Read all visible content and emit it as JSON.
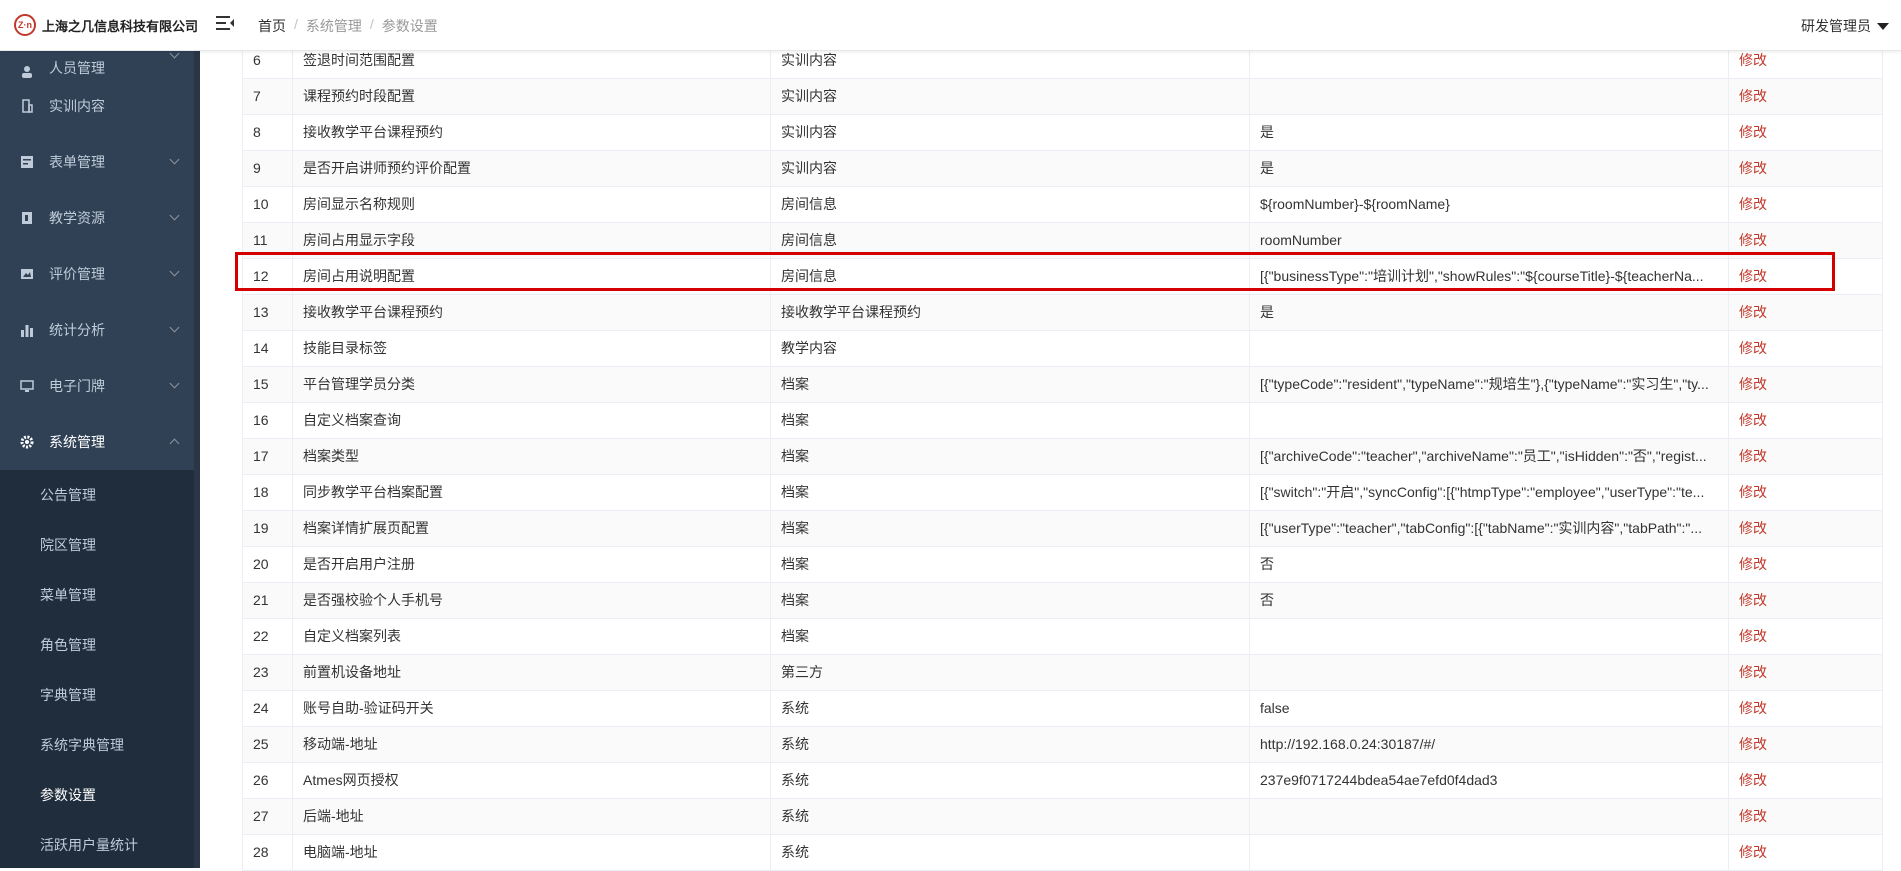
{
  "header": {
    "logo_mark": "Z·n",
    "company": "上海之几信息科技有限公司",
    "breadcrumb": [
      "首页",
      "系统管理",
      "参数设置"
    ],
    "user": "研发管理员"
  },
  "sidebar": {
    "top_partial": "人员管理",
    "items": [
      {
        "label": "实训内容",
        "icon": "building-icon"
      },
      {
        "label": "表单管理",
        "icon": "form-icon"
      },
      {
        "label": "教学资源",
        "icon": "book-icon"
      },
      {
        "label": "评价管理",
        "icon": "image-icon"
      },
      {
        "label": "统计分析",
        "icon": "bar-chart-icon"
      },
      {
        "label": "电子门牌",
        "icon": "monitor-icon"
      },
      {
        "label": "系统管理",
        "icon": "gear-icon"
      }
    ],
    "submenu": [
      "公告管理",
      "院区管理",
      "菜单管理",
      "角色管理",
      "字典管理",
      "系统字典管理",
      "参数设置",
      "活跃用户量统计"
    ],
    "active_sub": "参数设置"
  },
  "table": {
    "edit_label": "修改",
    "rows": [
      {
        "no": "6",
        "name": "签退时间范围配置",
        "category": "实训内容",
        "value": ""
      },
      {
        "no": "7",
        "name": "课程预约时段配置",
        "category": "实训内容",
        "value": ""
      },
      {
        "no": "8",
        "name": "接收教学平台课程预约",
        "category": "实训内容",
        "value": "是"
      },
      {
        "no": "9",
        "name": "是否开启讲师预约评价配置",
        "category": "实训内容",
        "value": "是"
      },
      {
        "no": "10",
        "name": "房间显示名称规则",
        "category": "房间信息",
        "value": "${roomNumber}-${roomName}"
      },
      {
        "no": "11",
        "name": "房间占用显示字段",
        "category": "房间信息",
        "value": "roomNumber"
      },
      {
        "no": "12",
        "name": "房间占用说明配置",
        "category": "房间信息",
        "value": "[{\"businessType\":\"培训计划\",\"showRules\":\"${courseTitle}-${teacherNa..."
      },
      {
        "no": "13",
        "name": "接收教学平台课程预约",
        "category": "接收教学平台课程预约",
        "value": "是"
      },
      {
        "no": "14",
        "name": "技能目录标签",
        "category": "教学内容",
        "value": ""
      },
      {
        "no": "15",
        "name": "平台管理学员分类",
        "category": "档案",
        "value": "[{\"typeCode\":\"resident\",\"typeName\":\"规培生\"},{\"typeName\":\"实习生\",\"ty..."
      },
      {
        "no": "16",
        "name": "自定义档案查询",
        "category": "档案",
        "value": ""
      },
      {
        "no": "17",
        "name": "档案类型",
        "category": "档案",
        "value": "[{\"archiveCode\":\"teacher\",\"archiveName\":\"员工\",\"isHidden\":\"否\",\"regist..."
      },
      {
        "no": "18",
        "name": "同步教学平台档案配置",
        "category": "档案",
        "value": "[{\"switch\":\"开启\",\"syncConfig\":[{\"htmpType\":\"employee\",\"userType\":\"te..."
      },
      {
        "no": "19",
        "name": "档案详情扩展页配置",
        "category": "档案",
        "value": "[{\"userType\":\"teacher\",\"tabConfig\":[{\"tabName\":\"实训内容\",\"tabPath\":\"..."
      },
      {
        "no": "20",
        "name": "是否开启用户注册",
        "category": "档案",
        "value": "否"
      },
      {
        "no": "21",
        "name": "是否强校验个人手机号",
        "category": "档案",
        "value": "否"
      },
      {
        "no": "22",
        "name": "自定义档案列表",
        "category": "档案",
        "value": ""
      },
      {
        "no": "23",
        "name": "前置机设备地址",
        "category": "第三方",
        "value": ""
      },
      {
        "no": "24",
        "name": "账号自助-验证码开关",
        "category": "系统",
        "value": "false"
      },
      {
        "no": "25",
        "name": "移动端-地址",
        "category": "系统",
        "value": "http://192.168.0.24:30187/#/"
      },
      {
        "no": "26",
        "name": "Atmes网页授权",
        "category": "系统",
        "value": "237e9f0717244bdea54ae7efd0f4dad3"
      },
      {
        "no": "27",
        "name": "后端-地址",
        "category": "系统",
        "value": ""
      },
      {
        "no": "28",
        "name": "电脑端-地址",
        "category": "系统",
        "value": ""
      }
    ]
  },
  "colors": {
    "sidebar_bg": "#304156",
    "submenu_bg": "#1f2d3d",
    "edit_link": "#c0392b",
    "highlight": "#d40000"
  }
}
